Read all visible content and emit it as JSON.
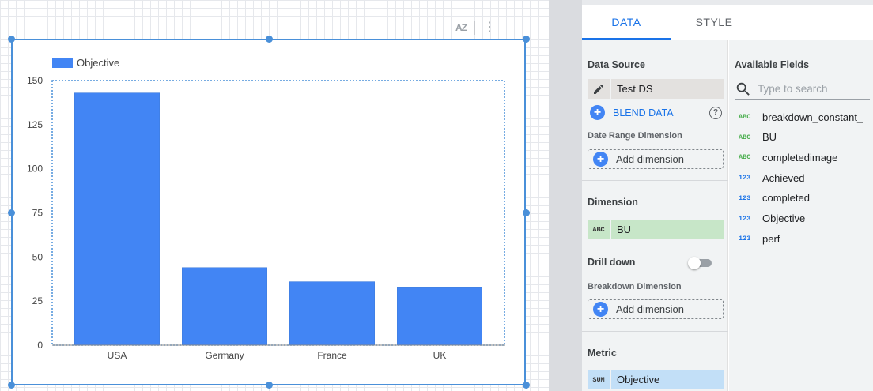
{
  "canvas": {
    "chart_toolbar": {
      "sort_icon_text": "AZ"
    }
  },
  "chart_data": {
    "type": "bar",
    "categories": [
      "USA",
      "Germany",
      "France",
      "UK"
    ],
    "series": [
      {
        "name": "Objective",
        "values": [
          143,
          44,
          36,
          33
        ],
        "color": "#4285f4"
      }
    ],
    "ylim": [
      0,
      150
    ],
    "yticks": [
      0,
      25,
      50,
      75,
      100,
      125,
      150
    ],
    "grid": false,
    "legend_position": "top-left"
  },
  "panel": {
    "tabs": [
      {
        "label": "DATA",
        "active": true
      },
      {
        "label": "STYLE",
        "active": false
      }
    ],
    "data_source": {
      "title": "Data Source",
      "name": "Test DS",
      "blend_label": "BLEND DATA",
      "help_icon_text": "?"
    },
    "date_range": {
      "title": "Date Range Dimension",
      "add_label": "Add dimension"
    },
    "dimension": {
      "title": "Dimension",
      "chip_type": "ABC",
      "chip_label": "BU"
    },
    "drill_down": {
      "label": "Drill down",
      "enabled": false
    },
    "breakdown": {
      "title": "Breakdown Dimension",
      "add_label": "Add dimension"
    },
    "metric": {
      "title": "Metric",
      "chip_type": "SUM",
      "chip_label": "Objective"
    },
    "available_fields": {
      "title": "Available Fields",
      "search_placeholder": "Type to search",
      "fields": [
        {
          "type": "ABC",
          "name": "breakdown_constant_"
        },
        {
          "type": "ABC",
          "name": "BU"
        },
        {
          "type": "ABC",
          "name": "completedimage"
        },
        {
          "type": "123",
          "name": "Achieved"
        },
        {
          "type": "123",
          "name": "completed"
        },
        {
          "type": "123",
          "name": "Objective"
        },
        {
          "type": "123",
          "name": "perf"
        }
      ]
    }
  }
}
